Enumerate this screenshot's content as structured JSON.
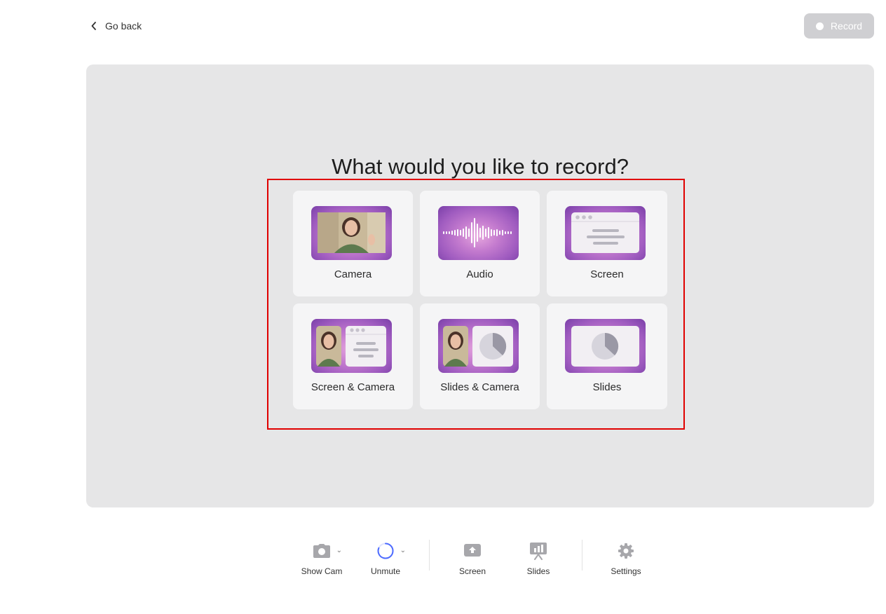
{
  "header": {
    "go_back_label": "Go back",
    "record_label": "Record"
  },
  "stage": {
    "question": "What would you like to record?",
    "options": [
      {
        "label": "Camera",
        "icon": "camera-preview-icon"
      },
      {
        "label": "Audio",
        "icon": "waveform-icon"
      },
      {
        "label": "Screen",
        "icon": "window-icon"
      },
      {
        "label": "Screen & Camera",
        "icon": "screen-camera-icon"
      },
      {
        "label": "Slides & Camera",
        "icon": "slides-camera-icon"
      },
      {
        "label": "Slides",
        "icon": "pie-chart-slide-icon"
      }
    ]
  },
  "toolbar": {
    "show_cam": "Show Cam",
    "unmute": "Unmute",
    "screen": "Screen",
    "slides": "Slides",
    "settings": "Settings"
  },
  "colors": {
    "stage_bg": "#e6e6e7",
    "card_bg": "#f5f5f6",
    "record_disabled": "#cfcfd2",
    "highlight_border": "#e00000",
    "thumb_purple": "#a05cc0",
    "spinner_blue": "#4d6bff"
  }
}
